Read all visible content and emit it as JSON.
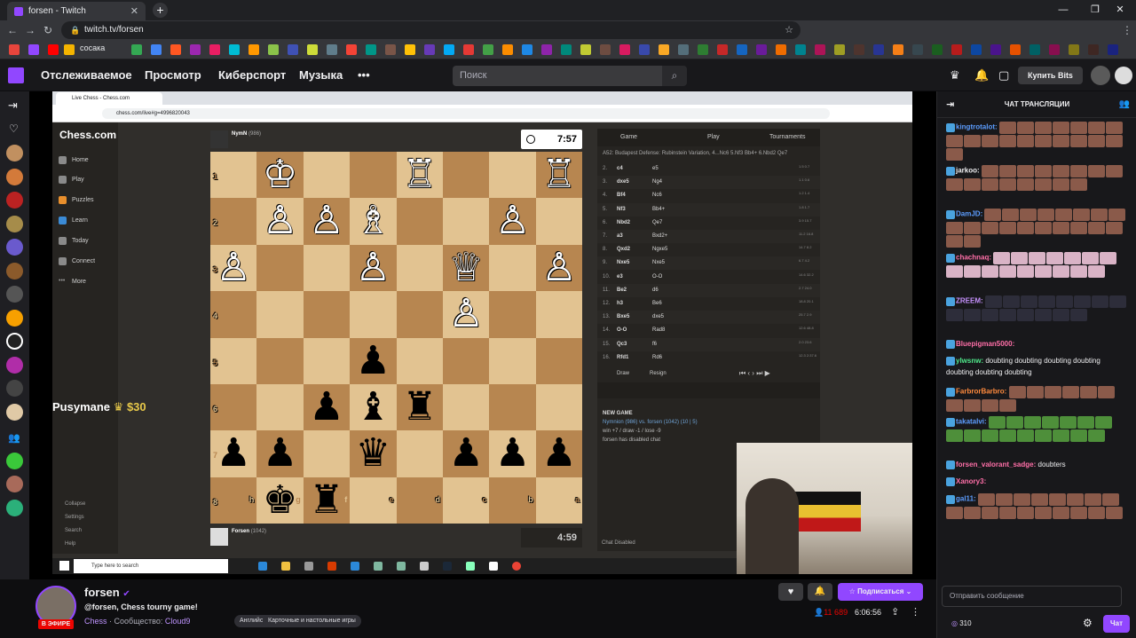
{
  "browser": {
    "tab_title": "forsen - Twitch",
    "url": "twitch.tv/forsen",
    "bookmark_label": "сосака"
  },
  "twitch_nav": {
    "items": [
      "Отслеживаемое",
      "Просмотр",
      "Киберспорт",
      "Музыка"
    ],
    "more": "•••",
    "search_placeholder": "Поиск",
    "bits_label": "Купить Bits"
  },
  "stream": {
    "inner_tab": "Live Chess - Chess.com",
    "inner_url": "chess.com/live#g=4996820043",
    "chesscom": {
      "logo": "Chess.com",
      "menu": [
        "Home",
        "Play",
        "Puzzles",
        "Learn",
        "Today",
        "Connect",
        "More"
      ],
      "bottom_menu": [
        "Collapse",
        "Settings",
        "Search",
        "Help"
      ]
    },
    "top_player": {
      "name": "NymN",
      "rating": "(986)",
      "clock": "7:57"
    },
    "bottom_player": {
      "name": "Forsen",
      "rating": "(1042)",
      "clock": "4:59"
    },
    "board_rows": [
      [
        "",
        "♔",
        "",
        "",
        "♖",
        "",
        "",
        "♖"
      ],
      [
        "",
        "♙",
        "♙",
        "♗",
        "",
        "",
        "♙",
        ""
      ],
      [
        "♙",
        "",
        "",
        "♙",
        "",
        "♕",
        "",
        "♙"
      ],
      [
        "",
        "",
        "",
        "",
        "",
        "♙",
        "",
        ""
      ],
      [
        "",
        "",
        "",
        "♟",
        "",
        "",
        "",
        ""
      ],
      [
        "",
        "",
        "♟",
        "♝",
        "♜",
        "",
        "",
        ""
      ],
      [
        "♟",
        "♟",
        "",
        "♛",
        "",
        "♟",
        "♟",
        "♟"
      ],
      [
        "",
        "♚",
        "♜",
        "",
        "",
        "",
        "",
        ""
      ]
    ],
    "rank_labels": [
      "1",
      "2",
      "3",
      "4",
      "5",
      "6",
      "7",
      "8"
    ],
    "file_labels": [
      "h",
      "g",
      "f",
      "e",
      "d",
      "c",
      "b",
      "a"
    ],
    "move_tabs": [
      "Game",
      "Play",
      "Tournaments"
    ],
    "opening": "A52: Budapest Defense: Rubinstein Variation, 4...Nc6 5.Nf3 Bb4+ 6.Nbd2 Qe7",
    "moves": [
      {
        "n": "2.",
        "w": "c4",
        "b": "e5",
        "t": "1.5 0.7"
      },
      {
        "n": "3.",
        "w": "dxe5",
        "b": "Ng4",
        "t": "1.1 0.6"
      },
      {
        "n": "4.",
        "w": "Bf4",
        "b": "Nc6",
        "t": "1.2 1.4"
      },
      {
        "n": "5.",
        "w": "Nf3",
        "b": "Bb4+",
        "t": "1.8 1.7"
      },
      {
        "n": "6.",
        "w": "Nbd2",
        "b": "Qe7",
        "t": "3.9 15.7"
      },
      {
        "n": "7.",
        "w": "a3",
        "b": "Bxd2+",
        "t": "11.2 16.8"
      },
      {
        "n": "8.",
        "w": "Qxd2",
        "b": "Ngxe5",
        "t": "14.7 8.2"
      },
      {
        "n": "9.",
        "w": "Nxe5",
        "b": "Nxe5",
        "t": "6.7 4.2"
      },
      {
        "n": "10.",
        "w": "e3",
        "b": "O-O",
        "t": "14.6 32.2"
      },
      {
        "n": "11.",
        "w": "Be2",
        "b": "d6",
        "t": "2.7 24.0"
      },
      {
        "n": "12.",
        "w": "h3",
        "b": "Be6",
        "t": "18.8 20.1"
      },
      {
        "n": "13.",
        "w": "Bxe5",
        "b": "dxe5",
        "t": "25.7 2.9"
      },
      {
        "n": "14.",
        "w": "O-O",
        "b": "Rad8",
        "t": "12.6 48.8"
      },
      {
        "n": "15.",
        "w": "Qc3",
        "b": "f6",
        "t": "2.0 23.6"
      },
      {
        "n": "16.",
        "w": "Rfd1",
        "b": "Rd6",
        "t": "12.3 2:37.6"
      }
    ],
    "draw": "Draw",
    "resign": "Resign",
    "new_game": "NEW GAME",
    "new_game_line": "Nymnion (986) vs. forsen (1042) (10 | 5)",
    "result_line": "win +7 / draw -1 / lose -9",
    "chat_off": "forsen has disabled chat",
    "chat_disabled": "Chat Disabled",
    "taskbar_search": "Type here to search",
    "donation_name": "Pusymane",
    "donation_amount": "$30"
  },
  "channel": {
    "name": "forsen",
    "live_badge": "В ЭФИРЕ",
    "title": "@forsen, Chess tourny game!",
    "game": "Chess",
    "community_label": "Сообщество:",
    "community": "Cloud9",
    "tags": [
      "Английский",
      "Карточные и настольные игры"
    ],
    "subscribe": "Подписаться",
    "viewers": "11 689",
    "uptime": "6:06:56"
  },
  "chat": {
    "header": "ЧАТ ТРАНСЛЯЦИИ",
    "input_placeholder": "Отправить сообщение",
    "points": "310",
    "send": "Чат",
    "messages": [
      {
        "user": "kingtrotalot:",
        "color": "#5c9dff",
        "text": "",
        "emotes": 18,
        "emote": "#8a5a4a"
      },
      {
        "user": "jarkoo:",
        "color": "#efeff1",
        "text": "",
        "emotes": 16,
        "emote": "#8a5a4a"
      },
      {
        "user": "DamJD:",
        "color": "#5c9dff",
        "text": "",
        "emotes": 20,
        "emote": "#8a5a4a"
      },
      {
        "user": "chachnaq:",
        "color": "#ff6fa8",
        "text": "",
        "emotes": 16,
        "emote": "#d9b3c6"
      },
      {
        "user": "ZREEM:",
        "color": "#c792ff",
        "text": "",
        "emotes": 16,
        "emote": "#2d2d3a"
      },
      {
        "user": "Bluepigman5000:",
        "color": "#ff6fa8",
        "text": "",
        "emotes": 0,
        "emote": ""
      },
      {
        "user": "ylwsnw:",
        "color": "#4fe88a",
        "text": "doubting doubting doubting doubting doubting doubting doubting",
        "emotes": 0,
        "emote": ""
      },
      {
        "user": "FarbrorBarbro:",
        "color": "#ff8a3d",
        "text": "",
        "emotes": 10,
        "emote": "#8a5a4a"
      },
      {
        "user": "takatalvi:",
        "color": "#5c9dff",
        "text": "",
        "emotes": 16,
        "emote": "#4e8f3a"
      },
      {
        "user": "forsen_valorant_sadge:",
        "color": "#ff6fa8",
        "text": "doubters",
        "emotes": 0,
        "emote": ""
      },
      {
        "user": "Xanory3:",
        "color": "#ff6fa8",
        "text": "",
        "emotes": 0,
        "emote": ""
      },
      {
        "user": "gal11:",
        "color": "#5c9dff",
        "text": "",
        "emotes": 18,
        "emote": "#8a5a4a"
      }
    ]
  }
}
